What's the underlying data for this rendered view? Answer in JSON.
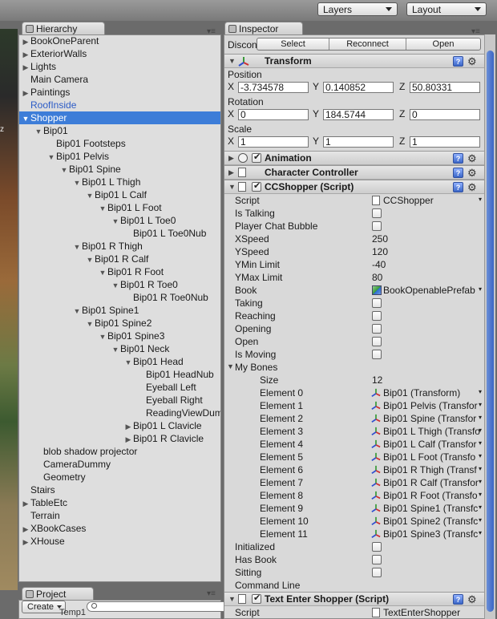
{
  "toolbar": {
    "layers_label": "Layers",
    "layout_label": "Layout"
  },
  "scene": {
    "edge_letter": "z"
  },
  "hierarchy": {
    "tab_label": "Hierarchy",
    "items": [
      {
        "label": "BookOneParent",
        "depth": 0,
        "arrow": "▶"
      },
      {
        "label": "ExteriorWalls",
        "depth": 0,
        "arrow": "▶"
      },
      {
        "label": "Lights",
        "depth": 0,
        "arrow": "▶"
      },
      {
        "label": "Main Camera",
        "depth": 0,
        "arrow": ""
      },
      {
        "label": "Paintings",
        "depth": 0,
        "arrow": "▶"
      },
      {
        "label": "RoofInside",
        "depth": 0,
        "arrow": "",
        "blue": true
      },
      {
        "label": "Shopper",
        "depth": 0,
        "arrow": "▼",
        "selected": true
      },
      {
        "label": "Bip01",
        "depth": 1,
        "arrow": "▼"
      },
      {
        "label": "Bip01 Footsteps",
        "depth": 2,
        "arrow": ""
      },
      {
        "label": "Bip01 Pelvis",
        "depth": 2,
        "arrow": "▼"
      },
      {
        "label": "Bip01 Spine",
        "depth": 3,
        "arrow": "▼"
      },
      {
        "label": "Bip01 L Thigh",
        "depth": 4,
        "arrow": "▼"
      },
      {
        "label": "Bip01 L Calf",
        "depth": 5,
        "arrow": "▼"
      },
      {
        "label": "Bip01 L Foot",
        "depth": 6,
        "arrow": "▼"
      },
      {
        "label": "Bip01 L Toe0",
        "depth": 7,
        "arrow": "▼"
      },
      {
        "label": "Bip01 L Toe0Nub",
        "depth": 8,
        "arrow": ""
      },
      {
        "label": "Bip01 R Thigh",
        "depth": 4,
        "arrow": "▼"
      },
      {
        "label": "Bip01 R Calf",
        "depth": 5,
        "arrow": "▼"
      },
      {
        "label": "Bip01 R Foot",
        "depth": 6,
        "arrow": "▼"
      },
      {
        "label": "Bip01 R Toe0",
        "depth": 7,
        "arrow": "▼"
      },
      {
        "label": "Bip01 R Toe0Nub",
        "depth": 8,
        "arrow": ""
      },
      {
        "label": "Bip01 Spine1",
        "depth": 4,
        "arrow": "▼"
      },
      {
        "label": "Bip01 Spine2",
        "depth": 5,
        "arrow": "▼"
      },
      {
        "label": "Bip01 Spine3",
        "depth": 6,
        "arrow": "▼"
      },
      {
        "label": "Bip01 Neck",
        "depth": 7,
        "arrow": "▼"
      },
      {
        "label": "Bip01 Head",
        "depth": 8,
        "arrow": "▼"
      },
      {
        "label": "Bip01 HeadNub",
        "depth": 9,
        "arrow": ""
      },
      {
        "label": "Eyeball Left",
        "depth": 9,
        "arrow": ""
      },
      {
        "label": "Eyeball Right",
        "depth": 9,
        "arrow": ""
      },
      {
        "label": "ReadingViewDum",
        "depth": 9,
        "arrow": ""
      },
      {
        "label": "Bip01 L Clavicle",
        "depth": 8,
        "arrow": "▶"
      },
      {
        "label": "Bip01 R Clavicle",
        "depth": 8,
        "arrow": "▶"
      },
      {
        "label": "blob shadow projector",
        "depth": 1,
        "arrow": ""
      },
      {
        "label": "CameraDummy",
        "depth": 1,
        "arrow": ""
      },
      {
        "label": "Geometry",
        "depth": 1,
        "arrow": ""
      },
      {
        "label": "Stairs",
        "depth": 0,
        "arrow": ""
      },
      {
        "label": "TableEtc",
        "depth": 0,
        "arrow": "▶"
      },
      {
        "label": "Terrain",
        "depth": 0,
        "arrow": ""
      },
      {
        "label": "XBookCases",
        "depth": 0,
        "arrow": "▶"
      },
      {
        "label": "XHouse",
        "depth": 0,
        "arrow": "▶"
      }
    ]
  },
  "project": {
    "tab_label": "Project",
    "create_label": "Create",
    "search_placeholder": "",
    "partial_item": "Temp1"
  },
  "inspector": {
    "tab_label": "Inspector",
    "prefab_bar": {
      "label": "Disconn",
      "select": "Select",
      "reconnect": "Reconnect",
      "open": "Open"
    },
    "transform": {
      "title": "Transform",
      "position_label": "Position",
      "rotation_label": "Rotation",
      "scale_label": "Scale",
      "axes": [
        "X",
        "Y",
        "Z"
      ],
      "position": [
        "-3.734578",
        "0.140852",
        "50.80331"
      ],
      "rotation": [
        "0",
        "184.5744",
        "0"
      ],
      "scale": [
        "1",
        "1",
        "1"
      ]
    },
    "animation": {
      "title": "Animation"
    },
    "character_controller": {
      "title": "Character Controller"
    },
    "ccshopper": {
      "title": "CCShopper (Script)",
      "script_label": "Script",
      "script_value": "CCShopper",
      "is_talking": "Is Talking",
      "player_chat_bubble": "Player Chat Bubble",
      "xspeed_label": "XSpeed",
      "xspeed": "250",
      "yspeed_label": "YSpeed",
      "yspeed": "120",
      "ymin_label": "YMin Limit",
      "ymin": "-40",
      "ymax_label": "YMax Limit",
      "ymax": "80",
      "book_label": "Book",
      "book_value": "BookOpenablePrefab",
      "taking": "Taking",
      "reaching": "Reaching",
      "opening": "Opening",
      "open": "Open",
      "is_moving": "Is Moving",
      "my_bones_label": "My Bones",
      "size_label": "Size",
      "size": "12",
      "elements": [
        {
          "label": "Element 0",
          "value": "Bip01 (Transform)"
        },
        {
          "label": "Element 1",
          "value": "Bip01 Pelvis (Transfor"
        },
        {
          "label": "Element 2",
          "value": "Bip01 Spine (Transfor"
        },
        {
          "label": "Element 3",
          "value": "Bip01 L Thigh (Transfo"
        },
        {
          "label": "Element 4",
          "value": "Bip01 L Calf (Transfor"
        },
        {
          "label": "Element 5",
          "value": "Bip01 L Foot (Transfo"
        },
        {
          "label": "Element 6",
          "value": "Bip01 R Thigh (Transf"
        },
        {
          "label": "Element 7",
          "value": "Bip01 R Calf (Transfor"
        },
        {
          "label": "Element 8",
          "value": "Bip01 R Foot (Transfo"
        },
        {
          "label": "Element 9",
          "value": "Bip01 Spine1 (Transfc"
        },
        {
          "label": "Element 10",
          "value": "Bip01 Spine2 (Transfc"
        },
        {
          "label": "Element 11",
          "value": "Bip01 Spine3 (Transfc"
        }
      ],
      "initialized": "Initialized",
      "has_book": "Has Book",
      "sitting": "Sitting",
      "command_line": "Command Line"
    },
    "text_enter": {
      "title": "Text Enter Shopper (Script)",
      "script_label": "Script",
      "script_value": "TextEnterShopper"
    }
  }
}
